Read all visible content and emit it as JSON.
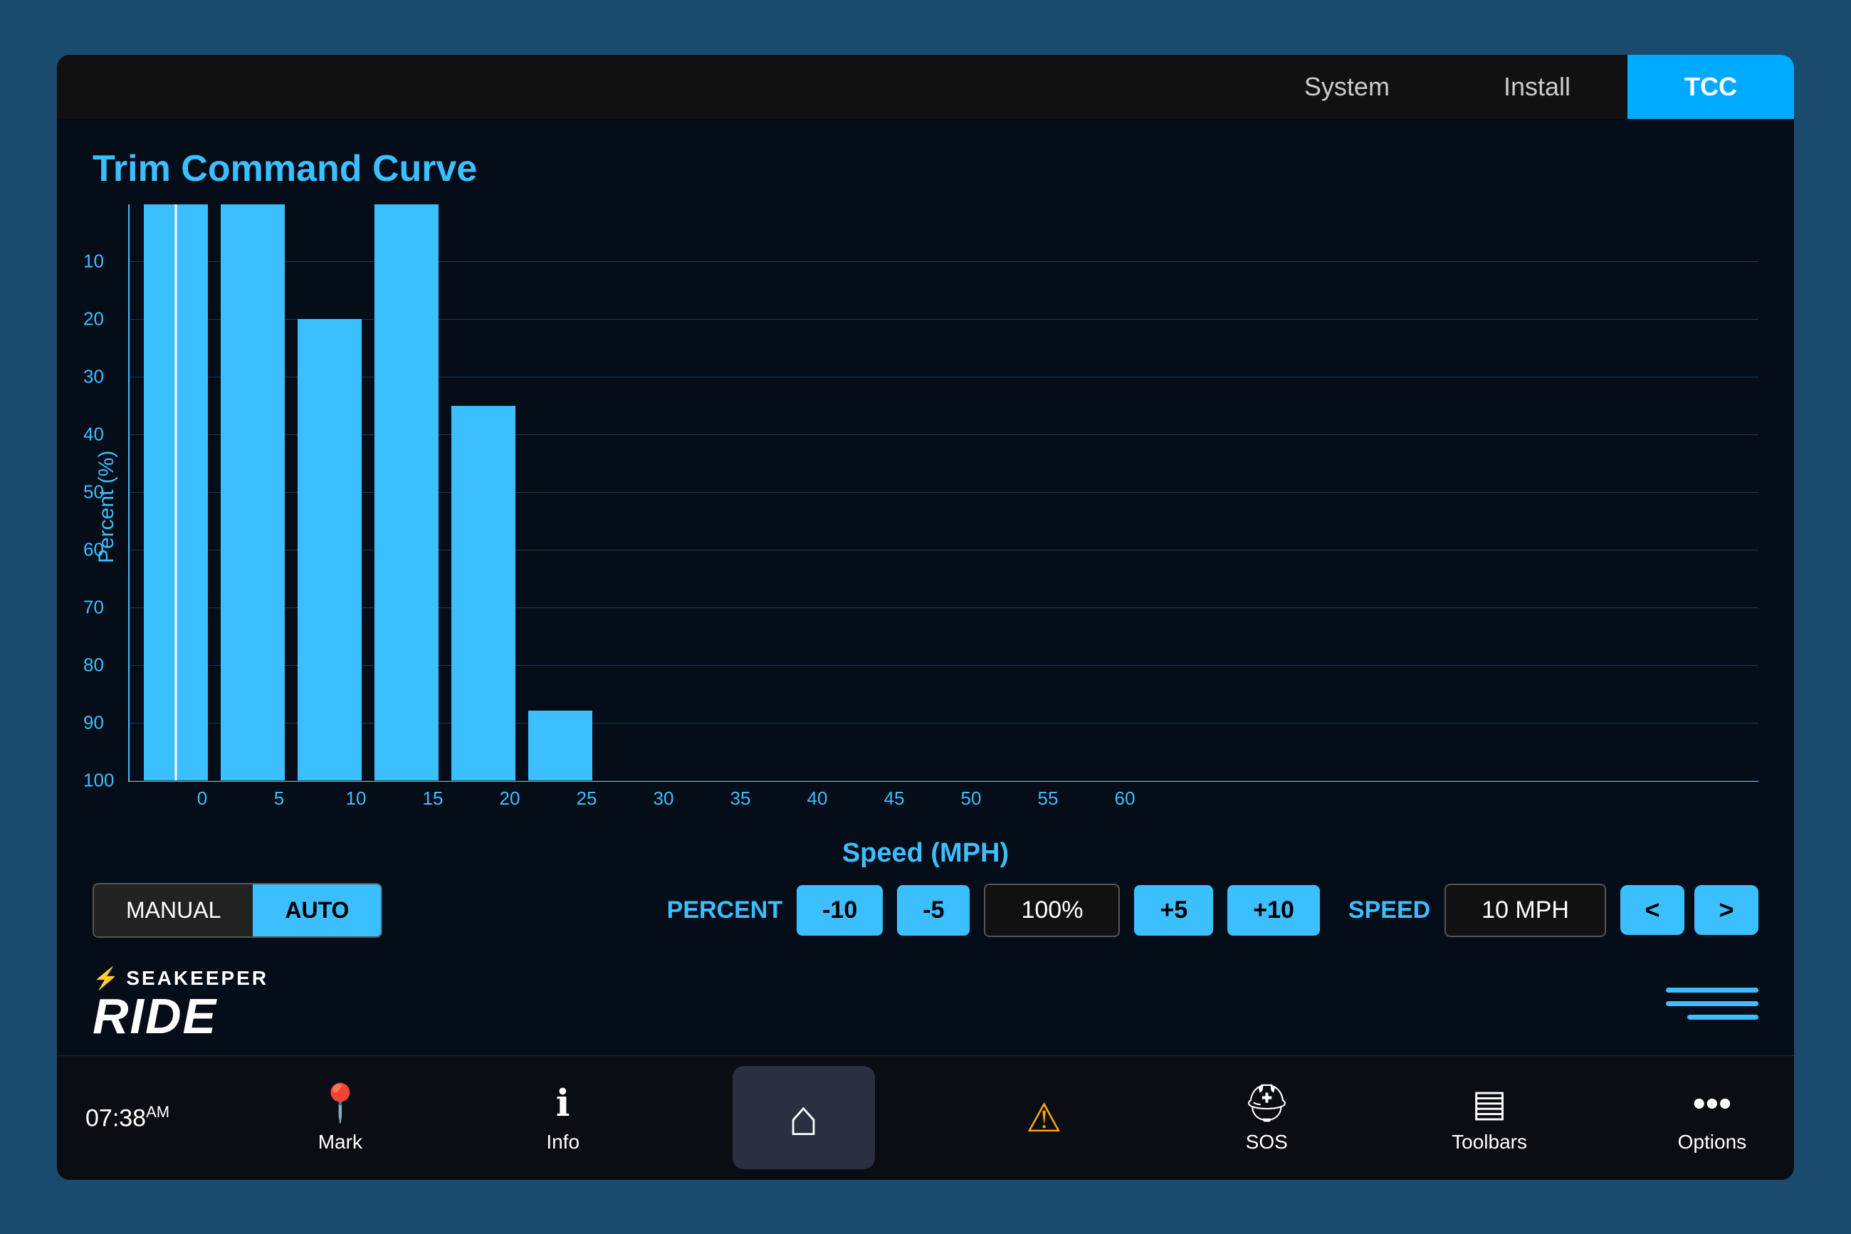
{
  "tabs": [
    {
      "label": "System",
      "active": false
    },
    {
      "label": "Install",
      "active": false
    },
    {
      "label": "TCC",
      "active": true
    }
  ],
  "chart": {
    "title": "Trim Command Curve",
    "y_axis_label": "Percent (%)",
    "x_axis_label": "Speed (MPH)",
    "y_ticks": [
      "10",
      "20",
      "30",
      "40",
      "50",
      "60",
      "70",
      "80",
      "90",
      "100"
    ],
    "bars": [
      {
        "height_pct": 100,
        "has_white_line": true
      },
      {
        "height_pct": 100,
        "has_white_line": false
      },
      {
        "height_pct": 80,
        "has_white_line": false
      },
      {
        "height_pct": 100,
        "has_white_line": false
      },
      {
        "height_pct": 65,
        "has_white_line": false
      },
      {
        "height_pct": 12,
        "has_white_line": false
      },
      {
        "height_pct": 0,
        "has_white_line": false
      },
      {
        "height_pct": 0,
        "has_white_line": false
      },
      {
        "height_pct": 0,
        "has_white_line": false
      },
      {
        "height_pct": 0,
        "has_white_line": false
      },
      {
        "height_pct": 0,
        "has_white_line": false
      },
      {
        "height_pct": 0,
        "has_white_line": false
      }
    ]
  },
  "controls": {
    "mode_manual": "MANUAL",
    "mode_auto": "AUTO",
    "active_mode": "AUTO",
    "percent_label": "PERCENT",
    "btn_minus10": "-10",
    "btn_minus5": "-5",
    "percent_value": "100%",
    "btn_plus5": "+5",
    "btn_plus10": "+10",
    "speed_label": "SPEED",
    "speed_value": "10 MPH",
    "nav_prev": "<",
    "nav_next": ">"
  },
  "logo": {
    "brand": "SEAKEEPER",
    "product": "RIDE"
  },
  "bottom_nav": {
    "time": "07:38",
    "time_suffix": "AM",
    "mark_label": "Mark",
    "info_label": "Info",
    "home_label": "",
    "sos_label": "SOS",
    "toolbars_label": "Toolbars",
    "options_label": "Options"
  }
}
